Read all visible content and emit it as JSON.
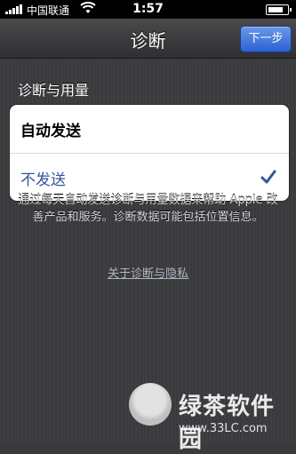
{
  "status_bar": {
    "carrier": "中国联通",
    "time": "1:57"
  },
  "nav": {
    "title": "诊断",
    "next_label": "下一步"
  },
  "section": {
    "header": "诊断与用量",
    "options": [
      {
        "label": "自动发送",
        "selected": false
      },
      {
        "label": "不发送",
        "selected": true
      }
    ]
  },
  "footer": {
    "description": "通过每天自动发送诊断与用量数据来帮助 Apple 改善产品和服务。诊断数据可能包括位置信息。",
    "privacy_link": "关于诊断与隐私"
  },
  "watermark": {
    "brand": "绿茶软件园",
    "url": "www.33LC.com"
  },
  "colors": {
    "accent_blue": "#2a62d4",
    "selected_text": "#35549c"
  }
}
